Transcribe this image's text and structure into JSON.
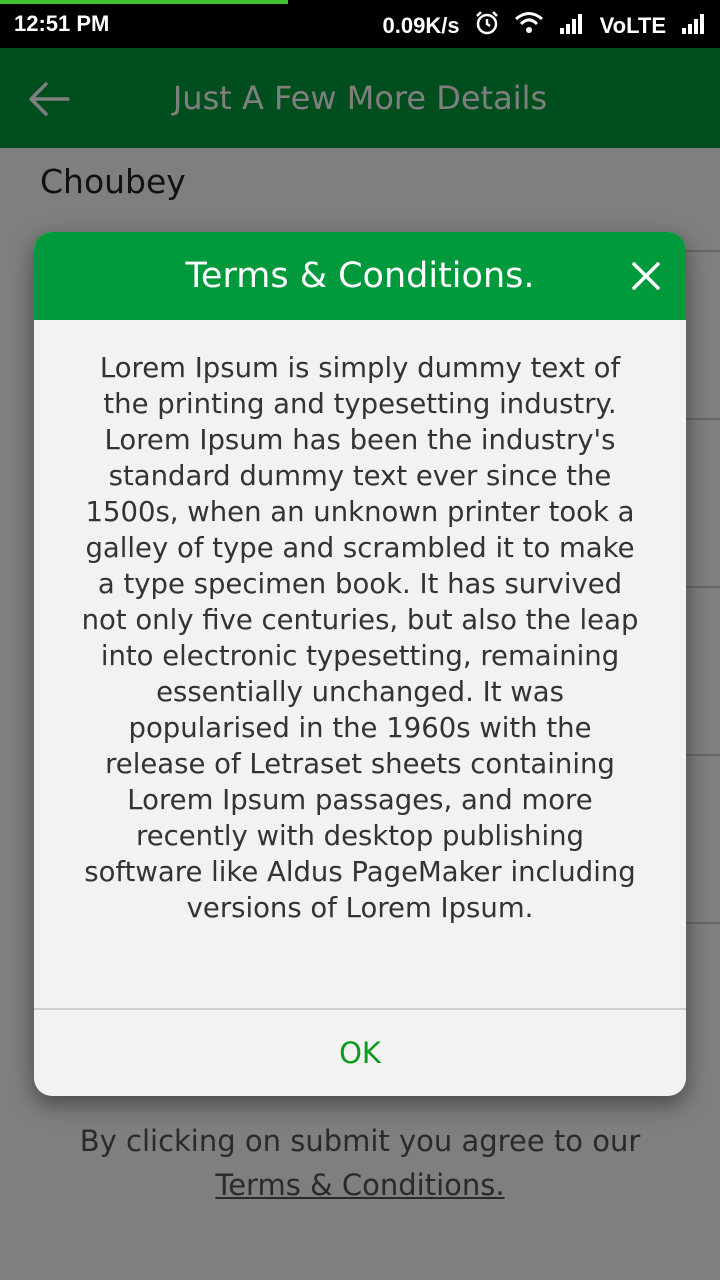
{
  "status_bar": {
    "time": "12:51 PM",
    "network_speed": "0.09K/s",
    "network_label": "VoLTE",
    "icons": [
      "alarm-icon",
      "wifi-icon",
      "signal-icon",
      "signal-icon"
    ]
  },
  "app_bar": {
    "title": "Just A Few More Details",
    "back_icon": "back-arrow-icon",
    "color": "#009a3d"
  },
  "form": {
    "last_name_value": "Choubey"
  },
  "footer": {
    "agree_text": "By clicking on submit you agree to our",
    "terms_link": "Terms & Conditions."
  },
  "dialog": {
    "title": "Terms & Conditions.",
    "close_icon": "close-icon",
    "body": "Lorem Ipsum is simply dummy text of the printing and typesetting industry. Lorem Ipsum has been the industry's standard dummy text ever since the 1500s, when an unknown printer took a galley of type and scrambled it to make a type specimen book. It has survived not only five centuries, but also the leap into electronic typesetting, remaining essentially unchanged. It was popularised in the 1960s with the release of Letraset sheets containing Lorem Ipsum passages, and more recently with desktop publishing software like Aldus PageMaker including versions of Lorem Ipsum.",
    "ok_label": "OK",
    "header_color": "#009a3d",
    "ok_color": "#0a9a1f"
  }
}
